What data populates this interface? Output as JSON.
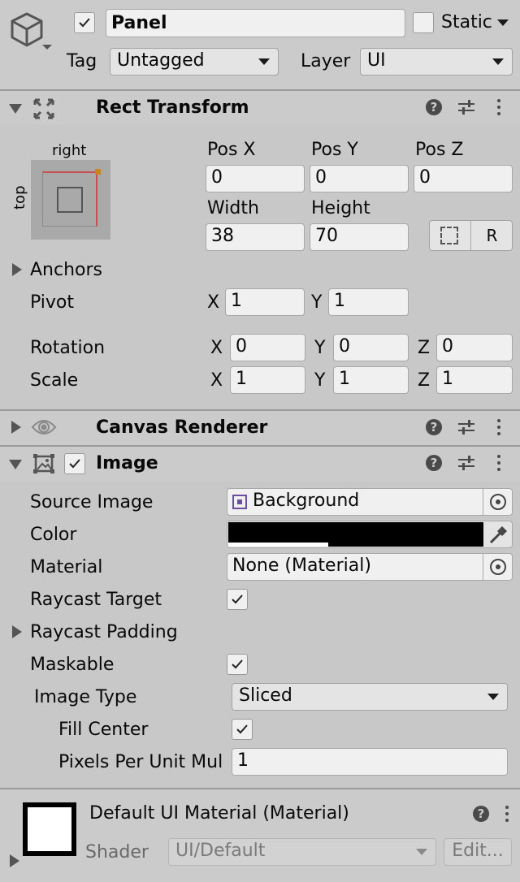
{
  "gameobject": {
    "name": "Panel",
    "static_label": "Static",
    "tag_label": "Tag",
    "tag_value": "Untagged",
    "layer_label": "Layer",
    "layer_value": "UI"
  },
  "rect_transform": {
    "title": "Rect Transform",
    "anchor_preset_h": "right",
    "anchor_preset_v": "top",
    "pos_x_label": "Pos X",
    "pos_y_label": "Pos Y",
    "pos_z_label": "Pos Z",
    "pos_x": "0",
    "pos_y": "0",
    "pos_z": "0",
    "width_label": "Width",
    "height_label": "Height",
    "width": "38",
    "height": "70",
    "raw_button": "R",
    "anchors_label": "Anchors",
    "pivot_label": "Pivot",
    "pivot_x_label": "X",
    "pivot_x": "1",
    "pivot_y_label": "Y",
    "pivot_y": "1",
    "rotation_label": "Rotation",
    "rot_x_label": "X",
    "rot_x": "0",
    "rot_y_label": "Y",
    "rot_y": "0",
    "rot_z_label": "Z",
    "rot_z": "0",
    "scale_label": "Scale",
    "scale_x_label": "X",
    "scale_x": "1",
    "scale_y_label": "Y",
    "scale_y": "1",
    "scale_z_label": "Z",
    "scale_z": "1"
  },
  "canvas_renderer": {
    "title": "Canvas Renderer"
  },
  "image": {
    "title": "Image",
    "source_image_label": "Source Image",
    "source_image_value": "Background",
    "color_label": "Color",
    "color_value": "#000000",
    "material_label": "Material",
    "material_value": "None (Material)",
    "raycast_target_label": "Raycast Target",
    "raycast_padding_label": "Raycast Padding",
    "maskable_label": "Maskable",
    "image_type_label": "Image Type",
    "image_type_value": "Sliced",
    "fill_center_label": "Fill Center",
    "pixels_per_unit_label": "Pixels Per Unit Mul",
    "pixels_per_unit_value": "1"
  },
  "material_preview": {
    "title": "Default UI Material (Material)",
    "shader_label": "Shader",
    "shader_value": "UI/Default",
    "edit_button": "Edit..."
  },
  "icons": [
    "gameobject-cube-icon",
    "rect-transform-icon",
    "canvas-renderer-eye-icon",
    "image-component-icon",
    "help-icon",
    "preset-sliders-icon",
    "kebab-menu-icon",
    "object-picker-icon",
    "eyedropper-icon",
    "blueprint-icon",
    "raw-edit-icon",
    "sprite-icon"
  ],
  "colors": {
    "background": "#c8c8c8",
    "field": "#f0f0f0",
    "anchor_red": "#c75050",
    "anchor_handle": "#c8861c",
    "sprite_purple": "#6a4fa0"
  }
}
